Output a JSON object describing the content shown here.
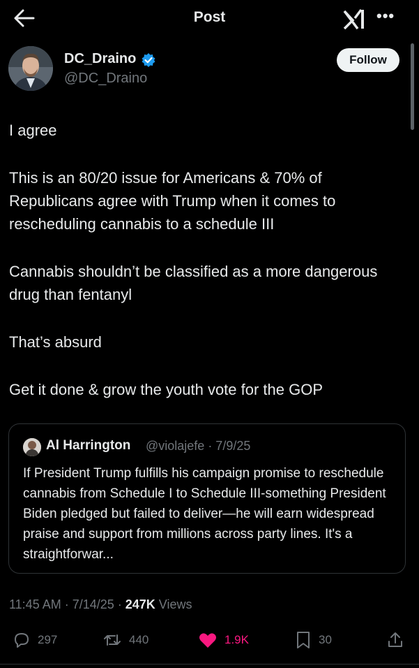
{
  "header": {
    "title": "Post",
    "back_icon": "arrow-left-icon",
    "logo_icon": "xai-grok-logo-icon",
    "more_icon": "more-dots-icon",
    "more_label": "•••"
  },
  "author": {
    "name": "DC_Draino",
    "handle": "@DC_Draino",
    "verified_color": "#1d9bf0",
    "follow_label": "Follow"
  },
  "post": {
    "paragraphs": [
      "I agree",
      "This is an 80/20 issue for Americans & 70% of Republicans agree with Trump when it comes to rescheduling cannabis to a schedule III",
      "Cannabis shouldn’t be classified as a more dangerous drug than fentanyl",
      "That’s absurd",
      "Get it done & grow the youth vote for the GOP"
    ]
  },
  "quote": {
    "name": "Al Harrington",
    "meta": "@violajefe · 7/9/25",
    "text": "If President Trump fulfills his campaign promise to reschedule cannabis from Schedule I to Schedule III-something President Biden pledged but failed to deliver—he will earn widespread praise and support from millions across party lines. It's a straightforwar..."
  },
  "stats": {
    "time_date": "11:45 AM · 7/14/25 · ",
    "views_count": "247K",
    "views_label": " Views"
  },
  "actions": {
    "replies": "297",
    "reposts": "440",
    "likes": "1.9K",
    "bookmarks": "30",
    "like_color": "#f91880"
  }
}
